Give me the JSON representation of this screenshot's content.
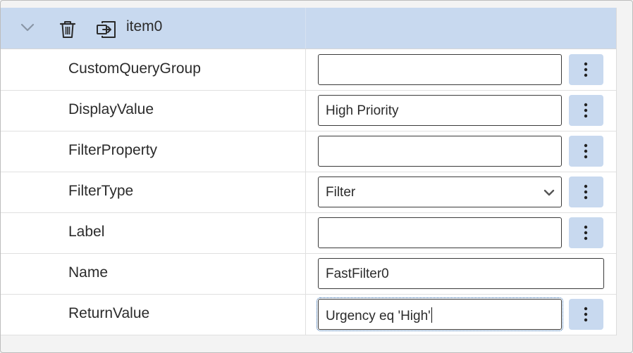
{
  "item": {
    "title": "item0"
  },
  "icons": {
    "expand": "chevron-down-icon",
    "delete": "trash-icon",
    "move": "move-to-icon",
    "more": "vertical-ellipsis-icon",
    "dropdown": "chevron-down-icon"
  },
  "colors": {
    "header_bg": "#c8d9ef",
    "button_bg": "#c8d9ef",
    "text": "#2b2b2b",
    "focus": "#1f5fa8"
  },
  "properties": [
    {
      "label": "CustomQueryGroup",
      "value": ""
    },
    {
      "label": "DisplayValue",
      "value": "High Priority"
    },
    {
      "label": "FilterProperty",
      "value": ""
    },
    {
      "label": "FilterType",
      "value": "Filter"
    },
    {
      "label": "Label",
      "value": ""
    },
    {
      "label": "Name",
      "value": "FastFilter0"
    },
    {
      "label": "ReturnValue",
      "value": "Urgency eq 'High'"
    }
  ]
}
